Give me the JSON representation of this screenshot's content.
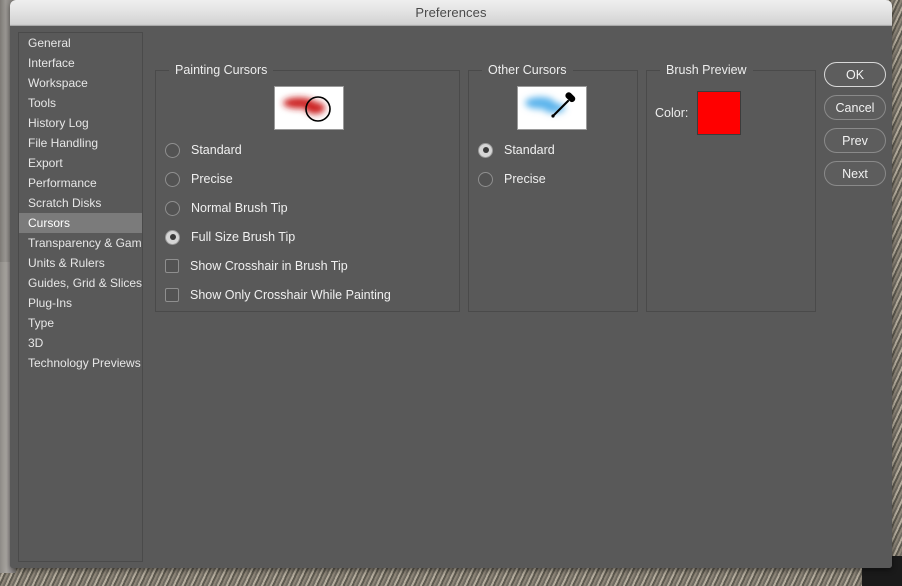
{
  "window": {
    "title": "Preferences"
  },
  "sidebar": {
    "items": [
      {
        "label": "General",
        "selected": false
      },
      {
        "label": "Interface",
        "selected": false
      },
      {
        "label": "Workspace",
        "selected": false
      },
      {
        "label": "Tools",
        "selected": false
      },
      {
        "label": "History Log",
        "selected": false
      },
      {
        "label": "File Handling",
        "selected": false
      },
      {
        "label": "Export",
        "selected": false
      },
      {
        "label": "Performance",
        "selected": false
      },
      {
        "label": "Scratch Disks",
        "selected": false
      },
      {
        "label": "Cursors",
        "selected": true
      },
      {
        "label": "Transparency & Gamut",
        "selected": false
      },
      {
        "label": "Units & Rulers",
        "selected": false
      },
      {
        "label": "Guides, Grid & Slices",
        "selected": false
      },
      {
        "label": "Plug-Ins",
        "selected": false
      },
      {
        "label": "Type",
        "selected": false
      },
      {
        "label": "3D",
        "selected": false
      },
      {
        "label": "Technology Previews",
        "selected": false
      }
    ]
  },
  "painting_cursors": {
    "title": "Painting Cursors",
    "preview": {
      "icon": "brush-stroke-preview",
      "stroke_color": "#cc2222",
      "background": "#ffffff",
      "ring_color": "#000000"
    },
    "options": [
      {
        "type": "radio",
        "label": "Standard",
        "checked": false
      },
      {
        "type": "radio",
        "label": "Precise",
        "checked": false
      },
      {
        "type": "radio",
        "label": "Normal Brush Tip",
        "checked": false
      },
      {
        "type": "radio",
        "label": "Full Size Brush Tip",
        "checked": true
      },
      {
        "type": "checkbox",
        "label": "Show Crosshair in Brush Tip",
        "checked": false
      },
      {
        "type": "checkbox",
        "label": "Show Only Crosshair While Painting",
        "checked": false
      }
    ]
  },
  "other_cursors": {
    "title": "Other Cursors",
    "preview": {
      "icon": "eyedropper-preview",
      "stroke_color": "#64b5ea",
      "background": "#ffffff"
    },
    "options": [
      {
        "type": "radio",
        "label": "Standard",
        "checked": true
      },
      {
        "type": "radio",
        "label": "Precise",
        "checked": false
      }
    ]
  },
  "brush_preview": {
    "title": "Brush Preview",
    "color_label": "Color:",
    "color_value": "#ff0000"
  },
  "buttons": [
    {
      "label": "OK",
      "default": true
    },
    {
      "label": "Cancel",
      "default": false
    },
    {
      "label": "Prev",
      "default": false
    },
    {
      "label": "Next",
      "default": false
    }
  ]
}
